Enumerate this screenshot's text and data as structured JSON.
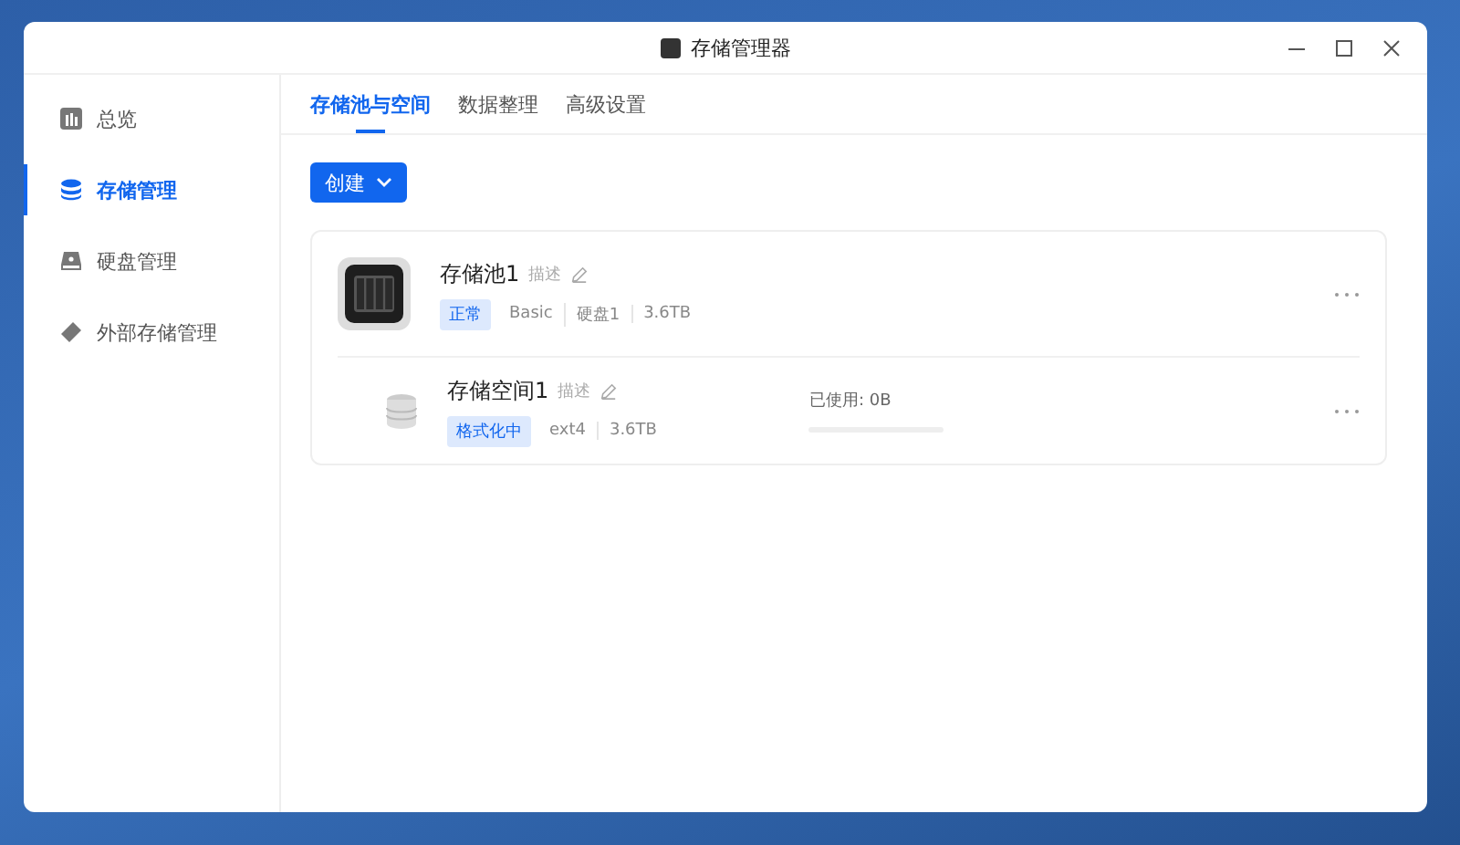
{
  "window": {
    "title": "存储管理器"
  },
  "sidebar": {
    "items": [
      {
        "label": "总览",
        "kind": "overview",
        "selected": false
      },
      {
        "label": "存储管理",
        "kind": "storage",
        "selected": true
      },
      {
        "label": "硬盘管理",
        "kind": "disk",
        "selected": false
      },
      {
        "label": "外部存储管理",
        "kind": "external",
        "selected": false
      }
    ]
  },
  "tabs": [
    {
      "label": "存储池与空间",
      "selected": true
    },
    {
      "label": "数据整理",
      "selected": false
    },
    {
      "label": "高级设置",
      "selected": false
    }
  ],
  "create_button": {
    "label": "创建"
  },
  "pool": {
    "name": "存储池1",
    "description": "描述",
    "status": "正常",
    "details": [
      "Basic",
      "硬盘1",
      "3.6TB"
    ],
    "volume": {
      "name": "存储空间1",
      "description": "描述",
      "status": "格式化中",
      "details": [
        "ext4",
        "3.6TB"
      ],
      "usage": "已使用: 0B",
      "level": 0
    }
  }
}
